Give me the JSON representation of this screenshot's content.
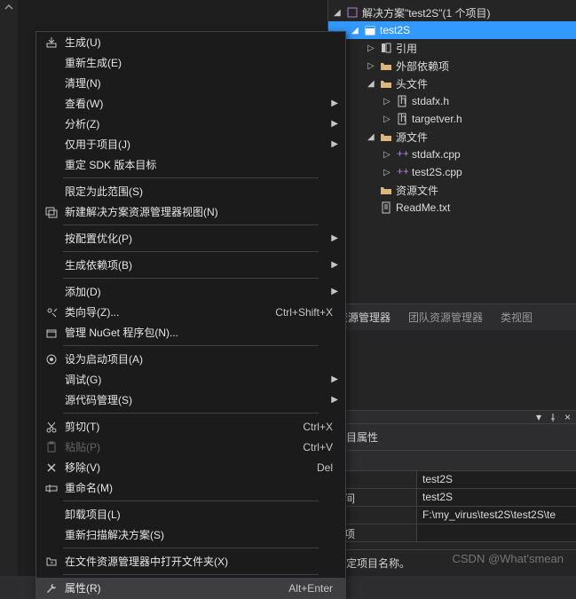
{
  "solution": {
    "header": "解决方案\"test2S\"(1 个项目)",
    "project": "test2S",
    "references": "引用",
    "externalDeps": "外部依赖项",
    "headerFiles": "头文件",
    "headerFile1": "stdafx.h",
    "headerFile2": "targetver.h",
    "sourceFiles": "源文件",
    "sourceFile1": "stdafx.cpp",
    "sourceFile2": "test2S.cpp",
    "resourceFiles": "资源文件",
    "readme": "ReadMe.txt"
  },
  "tabs": {
    "explorer": "资源管理器",
    "team": "团队资源管理器",
    "classView": "类视图"
  },
  "properties": {
    "title": "项目属性",
    "row1_label": "",
    "row1_value": "test2S",
    "row2_label": "空间",
    "row2_value": "test2S",
    "row3_label": "",
    "row3_value": "F:\\my_virus\\test2S\\test2S\\te",
    "row4_label": "赖项",
    "row4_value": "",
    "footer": "指定项目名称。"
  },
  "menu": {
    "build": "生成(U)",
    "rebuild": "重新生成(E)",
    "clean": "清理(N)",
    "view": "查看(W)",
    "analyze": "分析(Z)",
    "projectOnly": "仅用于项目(J)",
    "retarget": "重定 SDK 版本目标",
    "scopeTo": "限定为此范围(S)",
    "newView": "新建解决方案资源管理器视图(N)",
    "optimize": "按配置优化(P)",
    "buildDeps": "生成依赖项(B)",
    "add": "添加(D)",
    "classWizard": "类向导(Z)...",
    "classWizardShortcut": "Ctrl+Shift+X",
    "nuget": "管理 NuGet 程序包(N)...",
    "startup": "设为启动项目(A)",
    "debug": "调试(G)",
    "sourceControl": "源代码管理(S)",
    "cut": "剪切(T)",
    "cutShortcut": "Ctrl+X",
    "paste": "粘贴(P)",
    "pasteShortcut": "Ctrl+V",
    "remove": "移除(V)",
    "removeShortcut": "Del",
    "rename": "重命名(M)",
    "unload": "卸载项目(L)",
    "rescan": "重新扫描解决方案(S)",
    "openFolder": "在文件资源管理器中打开文件夹(X)",
    "props": "属性(R)",
    "propsShortcut": "Alt+Enter"
  },
  "watermark": "CSDN @What'smean"
}
